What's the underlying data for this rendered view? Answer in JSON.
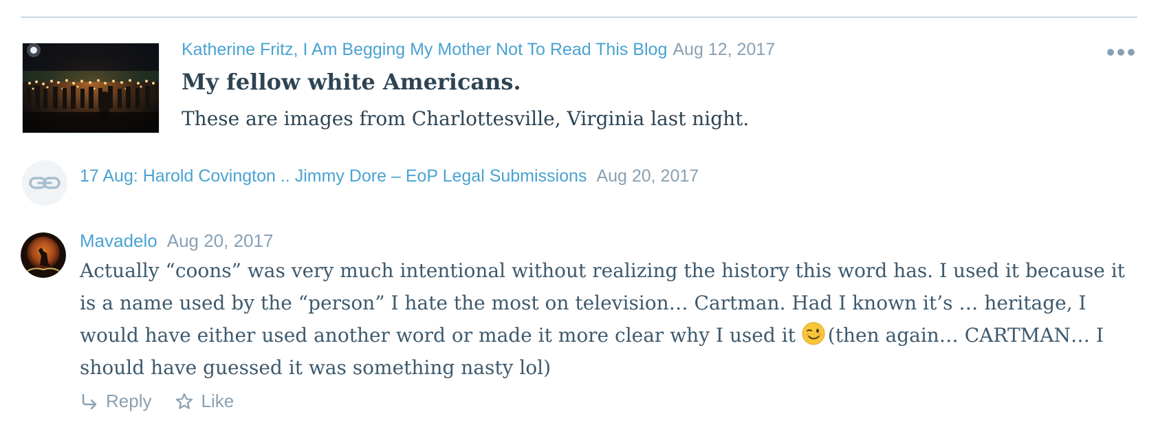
{
  "post": {
    "author": "Katherine Fritz, I Am Begging My Mother Not To Read This Blog",
    "date": "Aug 12, 2017",
    "title": "My fellow white Americans.",
    "excerpt": "These are images from Charlottesville, Virginia last night.",
    "thumbnail_icon": "torch-rally-photo",
    "more_icon": "ellipsis-icon"
  },
  "pingback": {
    "icon": "link-icon",
    "title": "17 Aug: Harold Covington .. Jimmy Dore – EoP Legal Submissions",
    "date": "Aug 20, 2017"
  },
  "comment": {
    "author": "Mavadelo",
    "date": "Aug 20, 2017",
    "avatar_icon": "wolf-moon-avatar",
    "text_part1": "Actually “coons” was very much intentional without realizing the history this word has. I used it because it is a name used by the “person” I hate the most on television… Cartman. Had I known it’s … heritage, I would have either used another word or made it more clear why I used it ",
    "emoji": "winking-face-emoji",
    "text_part2": "(then again… CARTMAN… I should have guessed it was something nasty lol)",
    "actions": {
      "reply_label": "Reply",
      "like_label": "Like"
    }
  },
  "colors": {
    "link": "#4aa2d2",
    "meta": "#8aa0b2",
    "title": "#2e4453",
    "body": "#3d596d",
    "divider": "#c8d7e1"
  }
}
